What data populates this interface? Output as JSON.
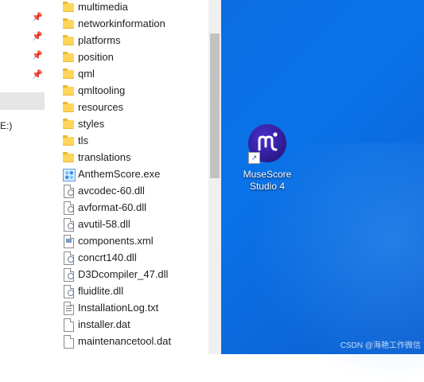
{
  "explorer": {
    "nav": {
      "drive_label": "E:)"
    },
    "files": [
      {
        "name": "multimedia",
        "type": "folder"
      },
      {
        "name": "networkinformation",
        "type": "folder"
      },
      {
        "name": "platforms",
        "type": "folder"
      },
      {
        "name": "position",
        "type": "folder"
      },
      {
        "name": "qml",
        "type": "folder"
      },
      {
        "name": "qmltooling",
        "type": "folder"
      },
      {
        "name": "resources",
        "type": "folder"
      },
      {
        "name": "styles",
        "type": "folder"
      },
      {
        "name": "tls",
        "type": "folder"
      },
      {
        "name": "translations",
        "type": "folder"
      },
      {
        "name": "AnthemScore.exe",
        "type": "exe"
      },
      {
        "name": "avcodec-60.dll",
        "type": "dll"
      },
      {
        "name": "avformat-60.dll",
        "type": "dll"
      },
      {
        "name": "avutil-58.dll",
        "type": "dll"
      },
      {
        "name": "components.xml",
        "type": "xml"
      },
      {
        "name": "concrt140.dll",
        "type": "dll"
      },
      {
        "name": "D3Dcompiler_47.dll",
        "type": "dll"
      },
      {
        "name": "fluidlite.dll",
        "type": "dll"
      },
      {
        "name": "InstallationLog.txt",
        "type": "txt"
      },
      {
        "name": "installer.dat",
        "type": "file"
      },
      {
        "name": "maintenancetool.dat",
        "type": "file"
      }
    ]
  },
  "desktop": {
    "shortcut": {
      "line1": "MuseScore",
      "line2": "Studio 4",
      "icon": "musescore-logo-icon"
    },
    "watermark": "CSDN @海艳工作微信"
  },
  "colors": {
    "desktop_blue": "#0a6be0",
    "folder_yellow": "#ffd55a",
    "musescore_purple": "#2c1a8c"
  }
}
